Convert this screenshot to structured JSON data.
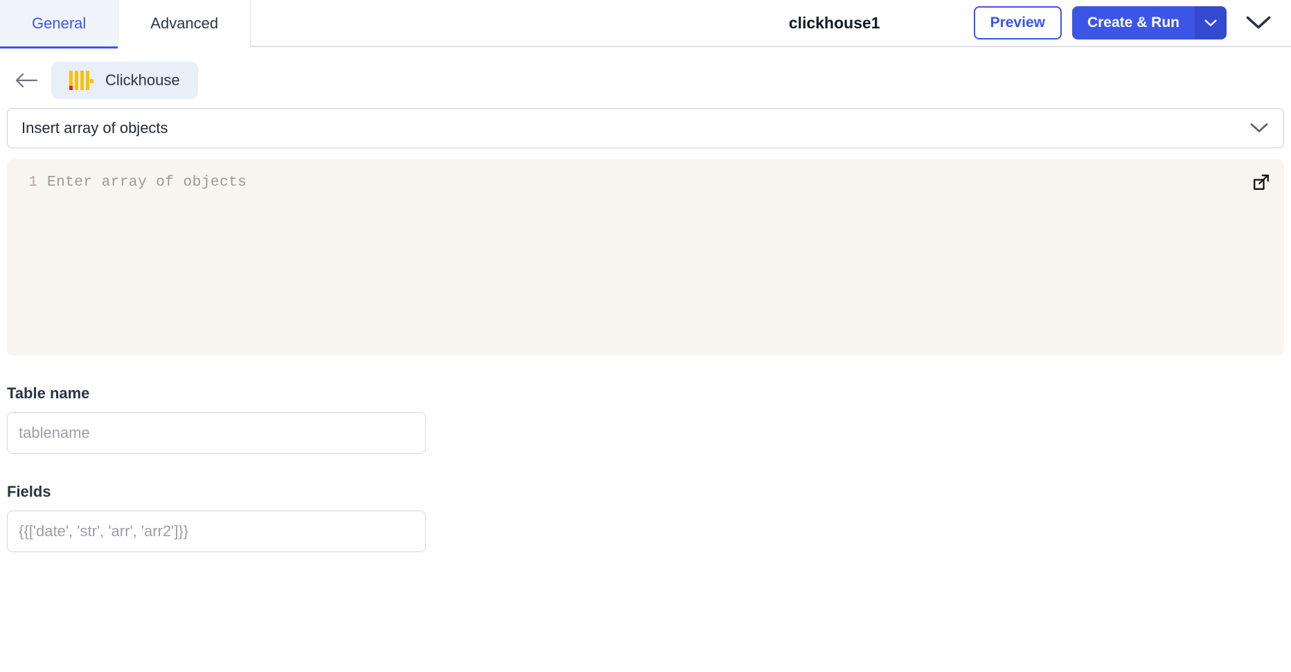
{
  "header": {
    "tabs": [
      {
        "label": "General",
        "active": true
      },
      {
        "label": "Advanced",
        "active": false
      }
    ],
    "title": "clickhouse1",
    "preview_label": "Preview",
    "create_run_label": "Create & Run",
    "create_run_caret_icon": "chevron-down-icon",
    "collapse_icon": "chevron-down-icon",
    "accent_color": "#3b55e6",
    "accent_dark_color": "#3349cf"
  },
  "breadcrumb": {
    "back_icon": "arrow-left-icon",
    "resource_label": "Clickhouse",
    "logo_icon": "clickhouse-logo-icon",
    "logo_bar_color": "#fac000",
    "logo_accent_color": "#e42222",
    "chip_background": "#e9eff9"
  },
  "operation": {
    "selected": "Insert array of objects",
    "caret_icon": "chevron-down-icon"
  },
  "editor": {
    "line_number": "1",
    "placeholder": "Enter array of objects",
    "value": "",
    "expand_icon": "external-link-icon",
    "background_color": "#f8f5f0"
  },
  "form": {
    "fields": [
      {
        "label": "Table name",
        "placeholder": "tablename",
        "value": "",
        "name": "table-name"
      },
      {
        "label": "Fields",
        "placeholder": "{{['date', 'str', 'arr', 'arr2']}}",
        "value": "",
        "name": "fields"
      }
    ]
  }
}
